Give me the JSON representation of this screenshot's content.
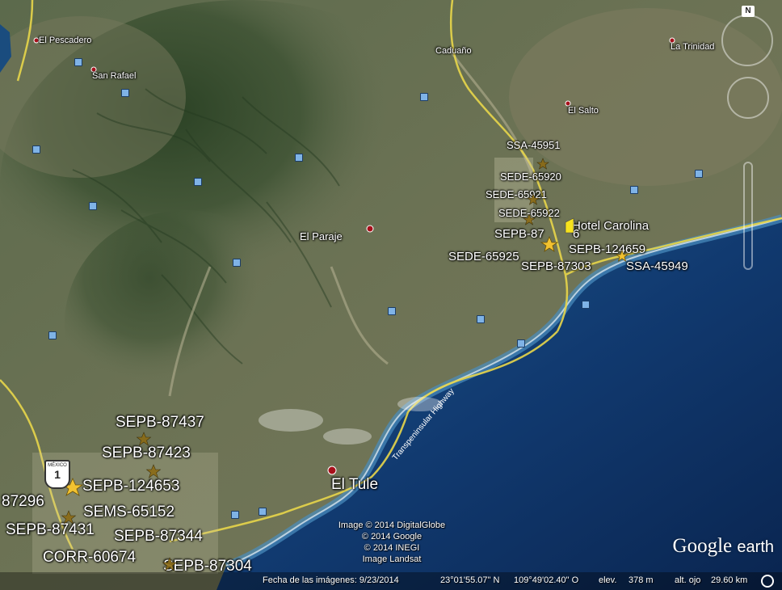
{
  "labels": {
    "el_pescadero": "El Pescadero",
    "san_rafael": "San Rafael",
    "caduano": "Caduaño",
    "la_trinidad": "La Trinidad",
    "el_salto": "El Salto",
    "el_paraje": "El Paraje",
    "el_tule": "El Tule",
    "ssa_45951": "SSA-45951",
    "sede_65920": "SEDE-65920",
    "sede_65921": "SEDE-65921",
    "sede_65922": "SEDE-65922",
    "hotel_carolina": "Hotel Carolina",
    "sepb_87": "SEPB-87",
    "sepb_87_suffix": "6",
    "sepb_124659": "SEPB-124659",
    "sede_65925": "SEDE-65925",
    "sepb_87303": "SEPB-87303",
    "ssa_45949": "SSA-45949",
    "sepb_87437": "SEPB-87437",
    "sepb_87423": "SEPB-87423",
    "sepb_124653": "SEPB-124653",
    "p_87296": "87296",
    "sems_65152": "SEMS-65152",
    "sepb_87431": "SEPB-87431",
    "sepb_87344": "SEPB-87344",
    "corr_60674": "CORR-60674",
    "sepb_87304": "SEPB-87304",
    "highway": "Transpeninsular Highway",
    "shield_country": "MÉXICO",
    "shield_number": "1"
  },
  "attribution": {
    "line1": "Image © 2014 DigitalGlobe",
    "line2": "© 2014 Google",
    "line3": "© 2014 INEGI",
    "line4": "Image Landsat"
  },
  "status": {
    "imagery_date": "Fecha de las imágenes: 9/23/2014",
    "lat": "23°01'55.07\" N",
    "lon": "109°49'02.40\" O",
    "elev_label": "elev.",
    "elev_value": "378 m",
    "eye_label": "alt. ojo",
    "eye_value": "29.60 km"
  },
  "logo": {
    "google": "Google",
    "earth": "earth"
  },
  "nav": {
    "north": "N"
  },
  "colors": {
    "road": "#e8d64a",
    "sea_deep": "#0c2a55",
    "sea_shallow": "#3d7fb0",
    "land": "#5b6548",
    "mountain": "#2f4528",
    "placemark": "#f2c230"
  }
}
